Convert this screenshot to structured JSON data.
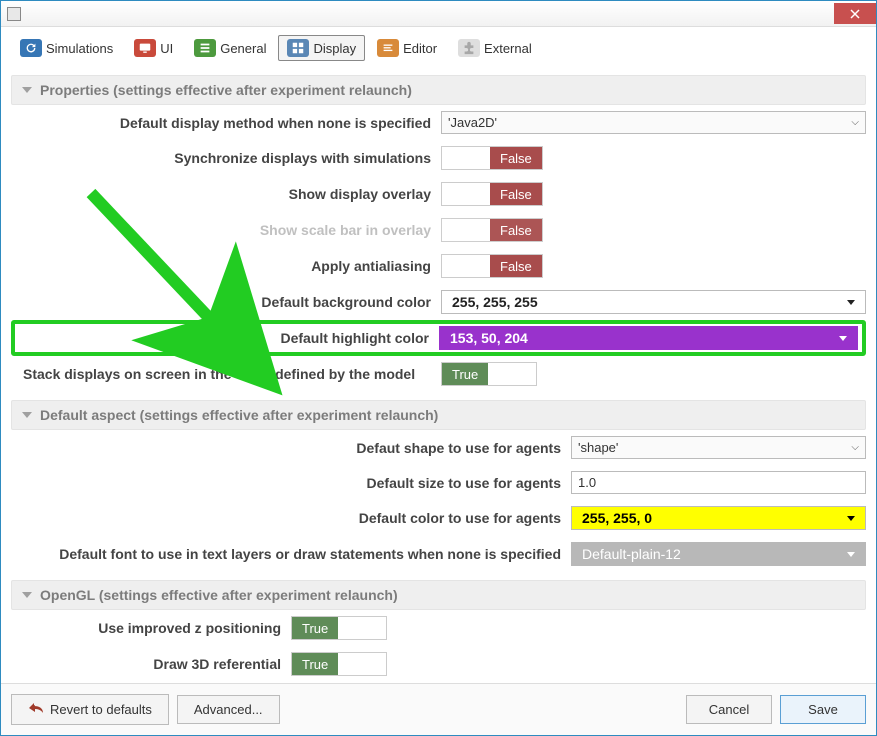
{
  "tabs": {
    "simulations": "Simulations",
    "ui": "UI",
    "general": "General",
    "display": "Display",
    "editor": "Editor",
    "external": "External"
  },
  "sections": {
    "properties_head": "Properties (settings effective after experiment relaunch)",
    "aspect_head": "Default aspect (settings effective after experiment relaunch)",
    "opengl_head": "OpenGL (settings effective after experiment relaunch)"
  },
  "props": {
    "default_display_method_label": "Default display method when none is specified",
    "default_display_method_value": "'Java2D'",
    "sync_label": "Synchronize displays with simulations",
    "sync_value": "False",
    "overlay_label": "Show display overlay",
    "overlay_value": "False",
    "scalebar_label": "Show scale bar in overlay",
    "scalebar_value": "False",
    "antialias_label": "Apply antialiasing",
    "antialias_value": "False",
    "bgcolor_label": "Default background color",
    "bgcolor_value": "255, 255, 255",
    "hlcolor_label": "Default highlight color",
    "hlcolor_value": "153, 50, 204",
    "stack_label": "Stack displays on screen in the order defined by the model",
    "stack_value": "True"
  },
  "aspect": {
    "shape_label": "Defaut shape to use for agents",
    "shape_value": "'shape'",
    "size_label": "Default size to use for agents",
    "size_value": "1.0",
    "color_label": "Default color to use for agents",
    "color_value": "255, 255, 0",
    "font_label": "Default font to use in text layers or draw statements when none is specified",
    "font_value": "Default-plain-12"
  },
  "opengl": {
    "zpos_label": "Use improved z positioning",
    "zpos_value": "True",
    "ref3d_label": "Draw 3D referential",
    "ref3d_value": "True"
  },
  "footer": {
    "revert": "Revert to defaults",
    "advanced": "Advanced...",
    "cancel": "Cancel",
    "save": "Save"
  }
}
